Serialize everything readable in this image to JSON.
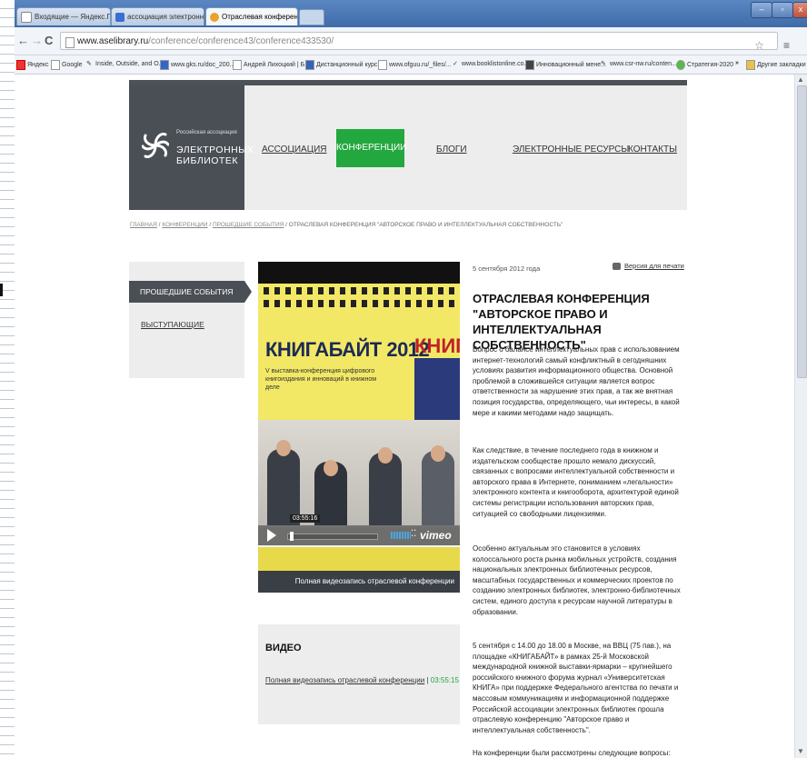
{
  "browser": {
    "tabs": [
      {
        "label": "Входящие — Яндекс.Почта",
        "icon": "mail-icon"
      },
      {
        "label": "ассоциация электронных б",
        "icon": "search-icon"
      },
      {
        "label": "Отраслевая конференция",
        "icon": "page-icon"
      }
    ],
    "url_host": "www.aselibrary.ru",
    "url_path": "/conference/conference43/conference433530/",
    "bookmarks": [
      "Яндекс",
      "Google",
      "Inside, Outside, and O...",
      "www.gks.ru/doc_200...",
      "Андрей Лихоцкий | Б...",
      "Дистанционный курс...",
      "www.ofguu.ru/_files/...",
      "www.booklistonline.co...",
      "Инновационный мене...",
      "www.csr-nw.ru/conten...",
      "Стратегия-2020",
      "»",
      "Другие закладки"
    ]
  },
  "site": {
    "logo_line1": "Российская ассоциация",
    "logo_line2": "ЭЛЕКТРОННЫХ",
    "logo_line3": "БИБЛИОТЕК",
    "nav": [
      "АССОЦИАЦИЯ",
      "КОНФЕРЕНЦИИ",
      "БЛОГИ",
      "ЭЛЕКТРОННЫЕ РЕСУРСЫ",
      "КОНТАКТЫ"
    ],
    "breadcrumbs": [
      "ГЛАВНАЯ",
      "КОНФЕРЕНЦИИ",
      "ПРОШЕДШИЕ СОБЫТИЯ"
    ],
    "breadcrumb_current": "ОТРАСЛЕВАЯ КОНФЕРЕНЦИЯ \"АВТОРСКОЕ ПРАВО И ИНТЕЛЛЕКТУАЛЬНАЯ СОБСТВЕННОСТЬ\"",
    "side": {
      "active": "ПРОШЕДШИЕ СОБЫТИЯ",
      "item": "ВЫСТУПАЮЩИЕ"
    }
  },
  "video": {
    "banner_title": "КНИГАБАЙТ 2012",
    "banner_title2": "КНИГ",
    "banner_subtitle": "V выставка-конференция цифрового книгоиздания и инноваций в книжном деле",
    "timestamp": "03:55:16",
    "brand": "vimeo",
    "caption": "Полная видеозапись отраслевой конференции"
  },
  "videobox": {
    "heading": "ВИДЕО",
    "link": "Полная видеозапись отраслевой конференции",
    "time": "03:55:15"
  },
  "article": {
    "date": "5 сентября 2012 года",
    "print": "Версия для печати",
    "title": "ОТРАСЛЕВАЯ КОНФЕРЕНЦИЯ \"АВТОРСКОЕ ПРАВО И ИНТЕЛЛЕКТУАЛЬНАЯ СОБСТВЕННОСТЬ\"",
    "p1": "Вопрос о балансе интеллектуальных прав с использованием интернет-технологий самый конфликтный в сегодняшних условиях развития информационного общества. Основной проблемой в сложившейся ситуации является вопрос ответственности за нарушение этих прав, а так же внятная позиция государства, определяющего, чьи интересы, в какой мере и какими методами надо защищать.",
    "p2": "Как следствие, в течение последнего года в книжном и издательском сообществе прошло немало дискуссий, связанных с вопросами интеллектуальной собственности и авторского права в Интернете, пониманием «легальности» электронного контента и книгооборота, архитектурой единой системы регистрации использования авторских прав, ситуацией со свободными лицензиями.",
    "p3": "Особенно актуальным это становится в условиях колоссального роста рынка мобильных устройств, создания национальных электронных библиотечных ресурсов, масштабных государственных и коммерческих проектов по созданию электронных библиотек, электронно-библиотечных систем, единого доступа к ресурсам научной литературы в образовании.",
    "p4": "5 сентября с 14.00 до 18.00 в Москве, на ВВЦ (75 пав.), на площадке «КНИГАБАЙТ» в рамках 25-й Московской международной книжной выставки-ярмарки – крупнейшего российского книжного форума журнал «Университетская КНИГА» при поддержке Федерального агентства по печати и массовым коммуникациям и информационной поддержке Российской ассоциации электронных библиотек прошла отраслевую конференцию \"Авторское право и интеллектуальная собственность\".",
    "p5": "На конференции были рассмотрены следующие вопросы:"
  }
}
